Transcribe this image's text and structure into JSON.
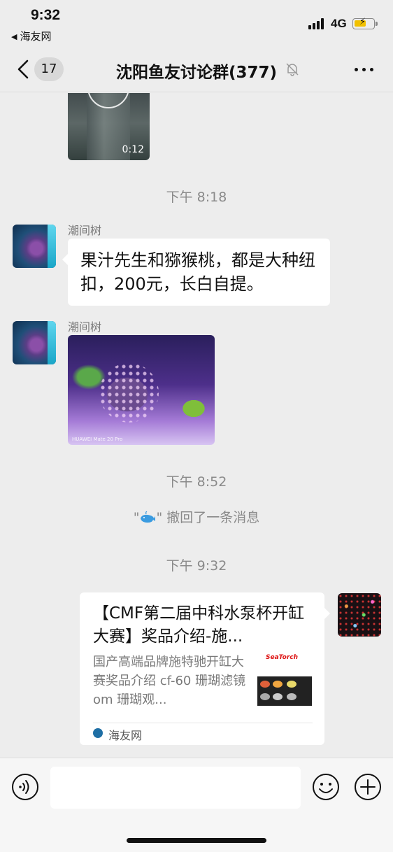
{
  "status": {
    "time": "9:32",
    "back_app": "海友网",
    "network": "4G"
  },
  "nav": {
    "unread_count": "17",
    "title": "沈阳鱼友讨论群(377)"
  },
  "messages": {
    "video_duration": "0:12",
    "time_1": "下午 8:18",
    "sender_1": "潮间树",
    "text_1": "果汁先生和猕猴桃，都是大种纽扣，200元，长白自提。",
    "sender_2": "潮间树",
    "photo_watermark": "HUAWEI Mate 20 Pro",
    "time_2": "下午 8:52",
    "recall_quote_open": "\"",
    "recall_quote_close": "\"",
    "recall_text": "撤回了一条消息",
    "time_3": "下午 9:32",
    "link_card": {
      "title": "【CMF第二届中科水泵杯开缸大赛】奖品介绍-施...",
      "description": "国产高端品牌施特驰开缸大赛奖品介绍 cf-60 珊瑚滤镜 om 珊瑚观...",
      "thumb_brand": "SeaTorch",
      "source": "海友网"
    }
  },
  "colors": {
    "background": "#ededed",
    "bubble": "#ffffff",
    "meta_text": "#8a8a8a"
  },
  "icons": {
    "back": "chevron-left-icon",
    "mute": "bell-slash-icon",
    "more": "ellipsis-icon",
    "voice": "voice-icon",
    "emoji": "smile-icon",
    "plus": "plus-circle-icon"
  }
}
